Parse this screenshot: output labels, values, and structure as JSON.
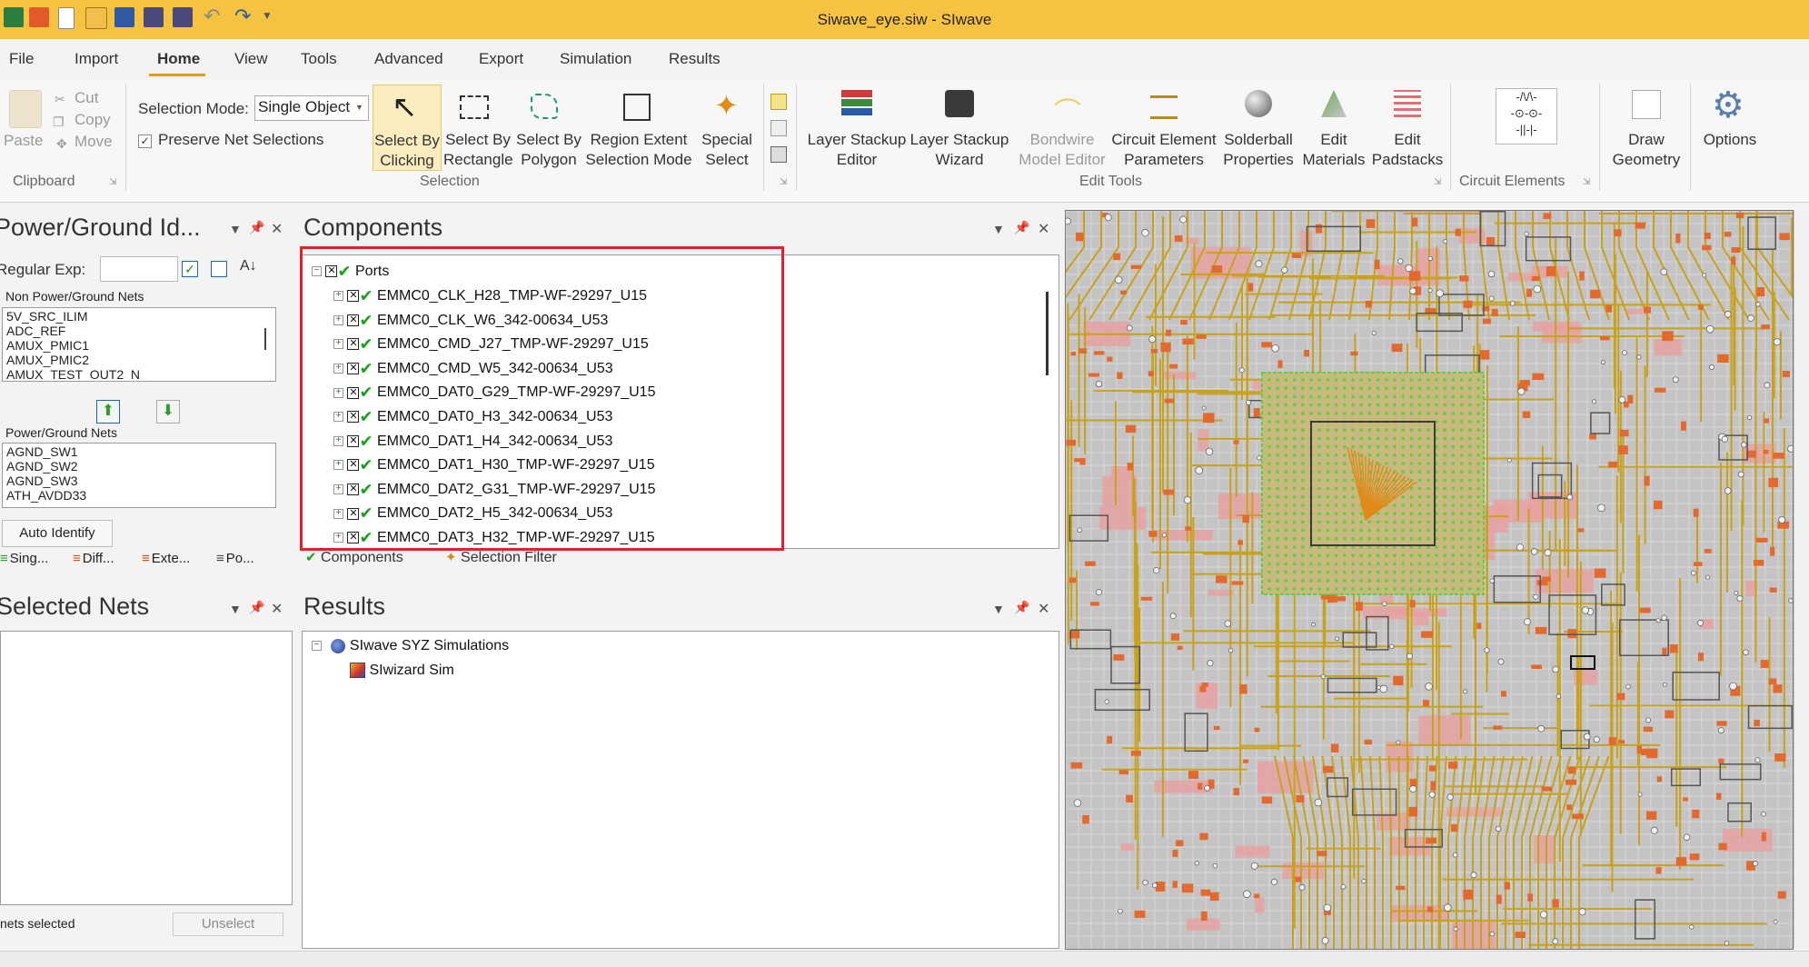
{
  "window": {
    "title": "Siwave_eye.siw - SIwave"
  },
  "quick_access": {
    "icons": [
      "save-icon",
      "open-icon",
      "new-icon",
      "undo-icon",
      "redo-icon"
    ]
  },
  "menu": {
    "file": "File",
    "import": "Import",
    "home": "Home",
    "view": "View",
    "tools": "Tools",
    "advanced": "Advanced",
    "export": "Export",
    "simulation": "Simulation",
    "results": "Results"
  },
  "ribbon": {
    "clipboard": {
      "paste": "Paste",
      "cut": "Cut",
      "copy": "Copy",
      "move": "Move",
      "group": "Clipboard"
    },
    "selection": {
      "mode_label": "Selection Mode:",
      "mode_value": "Single Object",
      "preserve": "Preserve Net Selections",
      "by_click_1": "Select By",
      "by_click_2": "Clicking",
      "by_rect_1": "Select By",
      "by_rect_2": "Rectangle",
      "by_poly_1": "Select By",
      "by_poly_2": "Polygon",
      "region_1": "Region Extent",
      "region_2": "Selection Mode",
      "special_1": "Special",
      "special_2": "Select",
      "group": "Selection"
    },
    "edit_tools": {
      "stack_ed_1": "Layer Stackup",
      "stack_ed_2": "Editor",
      "stack_wiz_1": "Layer Stackup",
      "stack_wiz_2": "Wizard",
      "bond_1": "Bondwire",
      "bond_2": "Model Editor",
      "cep_1": "Circuit Element",
      "cep_2": "Parameters",
      "sb_1": "Solderball",
      "sb_2": "Properties",
      "mat_1": "Edit",
      "mat_2": "Materials",
      "pad_1": "Edit",
      "pad_2": "Padstacks",
      "group": "Edit Tools"
    },
    "circuit": {
      "group": "Circuit Elements"
    },
    "draw_1": "Draw",
    "draw_2": "Geometry",
    "options": "Options"
  },
  "pg_panel": {
    "title": "Power/Ground Id...",
    "regexp_label": "Regular Exp:",
    "non_pg_label": "Non Power/Ground Nets",
    "non_pg_nets": [
      "5V_SRC_ILIM",
      "ADC_REF",
      "AMUX_PMIC1",
      "AMUX_PMIC2",
      "AMUX_TEST_OUT2_N"
    ],
    "pg_label": "Power/Ground Nets",
    "pg_nets": [
      "AGND_SW1",
      "AGND_SW2",
      "AGND_SW3",
      "ATH_AVDD33"
    ],
    "auto_identify": "Auto Identify",
    "tabs": [
      "Sing...",
      "Diff...",
      "Exte...",
      "Po..."
    ]
  },
  "selected_nets": {
    "title": "Selected Nets",
    "status": "nets selected",
    "unselect": "Unselect"
  },
  "components": {
    "title": "Components",
    "root": "Ports",
    "ports": [
      "EMMC0_CLK_H28_TMP-WF-29297_U15",
      "EMMC0_CLK_W6_342-00634_U53",
      "EMMC0_CMD_J27_TMP-WF-29297_U15",
      "EMMC0_CMD_W5_342-00634_U53",
      "EMMC0_DAT0_G29_TMP-WF-29297_U15",
      "EMMC0_DAT0_H3_342-00634_U53",
      "EMMC0_DAT1_H4_342-00634_U53",
      "EMMC0_DAT1_H30_TMP-WF-29297_U15",
      "EMMC0_DAT2_G31_TMP-WF-29297_U15",
      "EMMC0_DAT2_H5_342-00634_U53",
      "EMMC0_DAT3_H32_TMP-WF-29297_U15"
    ],
    "tab_components": "Components",
    "tab_filter": "Selection Filter"
  },
  "results": {
    "title": "Results",
    "root": "SIwave SYZ Simulations",
    "child": "SIwizard Sim"
  },
  "colors": {
    "titlebar": "#f6c242",
    "highlight": "#e0202a",
    "check": "#1aa31a",
    "trace_gold": "#c8a21a",
    "trace_pink": "#e8a0a0",
    "pad_orange": "#e26a2e",
    "bga_green": "#5cd23a"
  }
}
